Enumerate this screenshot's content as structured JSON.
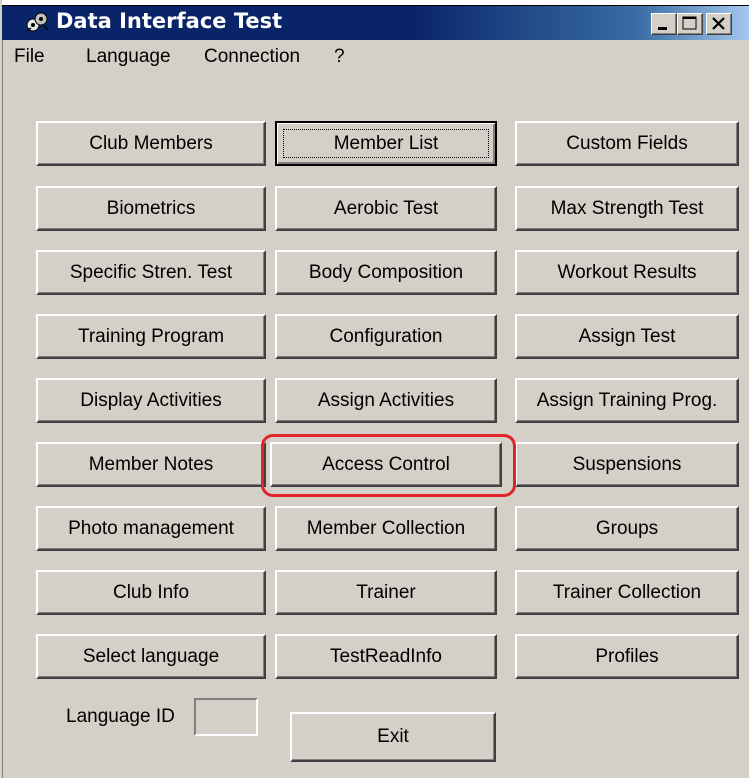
{
  "window": {
    "title": "Data Interface Test",
    "controls": {
      "minimize": "_",
      "maximize": "□",
      "close": "×"
    }
  },
  "menu": [
    "File",
    "Language",
    "Connection",
    "?"
  ],
  "buttons": [
    [
      "Club Members",
      "Member List",
      "Custom Fields"
    ],
    [
      "Biometrics",
      "Aerobic Test",
      "Max Strength Test"
    ],
    [
      "Specific Stren. Test",
      "Body Composition",
      "Workout Results"
    ],
    [
      "Training Program",
      "Configuration",
      "Assign Test"
    ],
    [
      "Display Activities",
      "Assign Activities",
      "Assign Training Prog."
    ],
    [
      "Member Notes",
      "Access Control",
      "Suspensions"
    ],
    [
      "Photo management",
      "Member Collection",
      "Groups"
    ],
    [
      "Club Info",
      "Trainer",
      "Trainer Collection"
    ],
    [
      "Select language",
      "TestReadInfo",
      "Profiles"
    ]
  ],
  "language_id": {
    "label": "Language ID",
    "value": ""
  },
  "exit_label": "Exit",
  "highlight": {
    "target": "Access Control",
    "color": "#e0242a"
  },
  "colors": {
    "title_bar": "#0a246a",
    "face": "#d4d0c8"
  }
}
